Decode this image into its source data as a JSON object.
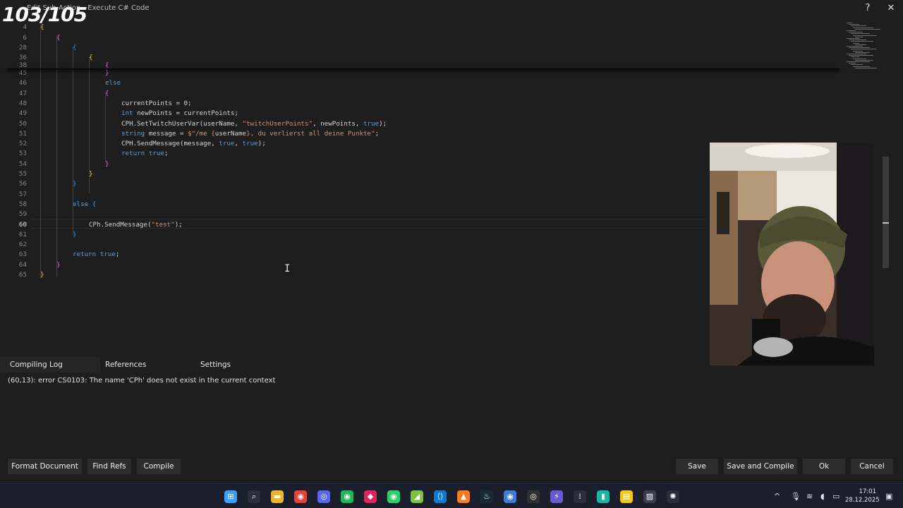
{
  "overlay": {
    "counter": "103/105"
  },
  "window": {
    "title": "Edit Sub-Action - Execute C# Code",
    "help_icon": "?",
    "close_icon": "✕"
  },
  "editor": {
    "sticky_lines": [
      {
        "n": "4",
        "segments": [
          {
            "t": "{",
            "c": "b1"
          }
        ],
        "indent": 0
      },
      {
        "n": "6",
        "segments": [
          {
            "t": "{",
            "c": "b2"
          }
        ],
        "indent": 1
      },
      {
        "n": "28",
        "segments": [
          {
            "t": "{",
            "c": "b3"
          }
        ],
        "indent": 2
      },
      {
        "n": "36",
        "segments": [
          {
            "t": "{",
            "c": "b1"
          }
        ],
        "indent": 3
      },
      {
        "n": "38",
        "segments": [
          {
            "t": "{",
            "c": "b2"
          }
        ],
        "indent": 4
      }
    ],
    "lines": [
      {
        "n": "45",
        "segments": [
          {
            "t": "}",
            "c": "b2"
          }
        ],
        "indent": 4
      },
      {
        "n": "46",
        "segments": [
          {
            "t": "else",
            "c": "kw"
          }
        ],
        "indent": 4
      },
      {
        "n": "47",
        "segments": [
          {
            "t": "{",
            "c": "b2"
          }
        ],
        "indent": 4
      },
      {
        "n": "48",
        "segments": [
          {
            "t": "currentPoints = 0;",
            "c": "pl"
          }
        ],
        "indent": 5
      },
      {
        "n": "49",
        "segments": [
          {
            "t": "int",
            "c": "kw"
          },
          {
            "t": " newPoints = currentPoints;",
            "c": "pl"
          }
        ],
        "indent": 5
      },
      {
        "n": "50",
        "segments": [
          {
            "t": "CPH.SetTwitchUserVar(userName, ",
            "c": "pl"
          },
          {
            "t": "\"twitchUserPoints\"",
            "c": "st"
          },
          {
            "t": ", newPoints, ",
            "c": "pl"
          },
          {
            "t": "true",
            "c": "kw"
          },
          {
            "t": ");",
            "c": "pl"
          }
        ],
        "indent": 5
      },
      {
        "n": "51",
        "segments": [
          {
            "t": "string",
            "c": "kw"
          },
          {
            "t": " message = ",
            "c": "pl"
          },
          {
            "t": "$\"/me {",
            "c": "st"
          },
          {
            "t": "userName",
            "c": "pl"
          },
          {
            "t": "}, du verlierst all deine Punkte\"",
            "c": "st"
          },
          {
            "t": ";",
            "c": "pl"
          }
        ],
        "indent": 5
      },
      {
        "n": "52",
        "segments": [
          {
            "t": "CPH.SendMessage(message, ",
            "c": "pl"
          },
          {
            "t": "true",
            "c": "kw"
          },
          {
            "t": ", ",
            "c": "pl"
          },
          {
            "t": "true",
            "c": "kw"
          },
          {
            "t": ");",
            "c": "pl"
          }
        ],
        "indent": 5
      },
      {
        "n": "53",
        "segments": [
          {
            "t": "return",
            "c": "kw"
          },
          {
            "t": " ",
            "c": "pl"
          },
          {
            "t": "true",
            "c": "kw"
          },
          {
            "t": ";",
            "c": "pl"
          }
        ],
        "indent": 5
      },
      {
        "n": "54",
        "segments": [
          {
            "t": "}",
            "c": "b2"
          }
        ],
        "indent": 4
      },
      {
        "n": "55",
        "segments": [
          {
            "t": "}",
            "c": "b1"
          }
        ],
        "indent": 3
      },
      {
        "n": "56",
        "segments": [
          {
            "t": "}",
            "c": "b3"
          }
        ],
        "indent": 2
      },
      {
        "n": "57",
        "segments": [],
        "indent": 0
      },
      {
        "n": "58",
        "segments": [
          {
            "t": "else",
            "c": "kw"
          },
          {
            "t": " ",
            "c": "pl"
          },
          {
            "t": "{",
            "c": "b3"
          }
        ],
        "indent": 2
      },
      {
        "n": "59",
        "segments": [],
        "indent": 0
      },
      {
        "n": "60",
        "segments": [
          {
            "t": "CPh.SendMessage(",
            "c": "pl"
          },
          {
            "t": "\"test\"",
            "c": "st"
          },
          {
            "t": ");",
            "c": "pl"
          }
        ],
        "indent": 3,
        "current": true
      },
      {
        "n": "61",
        "segments": [
          {
            "t": "}",
            "c": "b3"
          }
        ],
        "indent": 2
      },
      {
        "n": "62",
        "segments": [],
        "indent": 0
      },
      {
        "n": "63",
        "segments": [
          {
            "t": "return",
            "c": "kw"
          },
          {
            "t": " ",
            "c": "pl"
          },
          {
            "t": "true",
            "c": "kw"
          },
          {
            "t": ";",
            "c": "pl"
          }
        ],
        "indent": 2
      },
      {
        "n": "64",
        "segments": [
          {
            "t": "}",
            "c": "b2"
          }
        ],
        "indent": 1
      },
      {
        "n": "65",
        "segments": [
          {
            "t": "}",
            "c": "b1"
          }
        ],
        "indent": 0
      }
    ]
  },
  "tabs": [
    {
      "label": "Compiling Log",
      "active": true
    },
    {
      "label": "References",
      "active": false
    },
    {
      "label": "Settings",
      "active": false
    }
  ],
  "log": {
    "message": "(60,13): error CS0103: The name 'CPh' does not exist in the current context"
  },
  "buttons": {
    "format": "Format Document",
    "find_refs": "Find Refs",
    "compile": "Compile",
    "save": "Save",
    "save_compile": "Save and Compile",
    "ok": "Ok",
    "cancel": "Cancel"
  },
  "taskbar": {
    "icons": [
      "windows-start-icon",
      "search-icon",
      "file-explorer-icon",
      "chrome-icon",
      "discord-icon",
      "spotify-icon",
      "red-app-icon",
      "whatsapp-icon",
      "green-app-icon",
      "vscode-icon",
      "orange-app-icon",
      "steam-icon",
      "blue-app-icon",
      "obs-icon",
      "streamerbot-icon",
      "audio-app-icon",
      "teal-app-icon",
      "sticky-notes-icon",
      "photo-app-icon",
      "chatgpt-icon"
    ],
    "time": "17:01",
    "date": "28.12.2025"
  },
  "colors": {
    "accent": "#569cd6",
    "string": "#ce9178",
    "bracket1": "#ffd700",
    "bracket2": "#da70d6",
    "bracket3": "#179fff"
  }
}
